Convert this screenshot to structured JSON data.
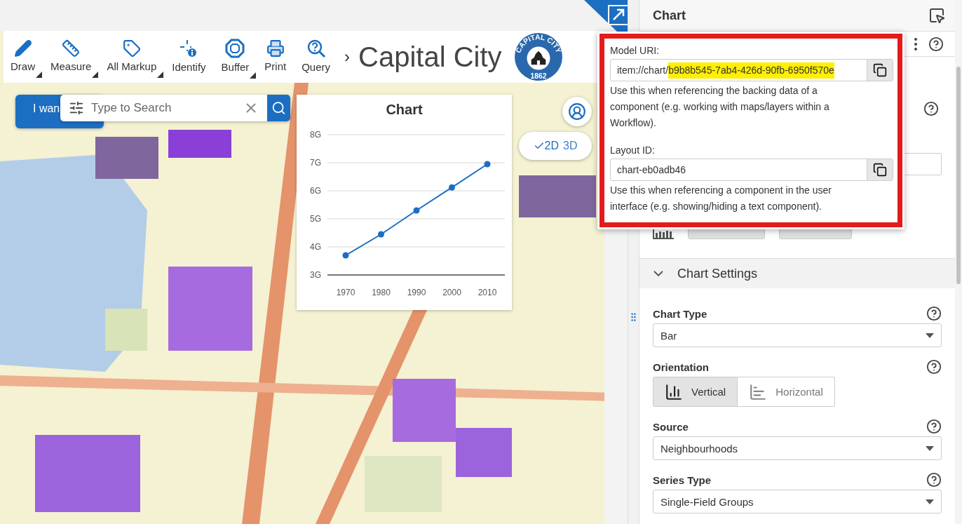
{
  "map_toolbar": {
    "tools": [
      {
        "label": "Draw",
        "has_menu": true
      },
      {
        "label": "Measure",
        "has_menu": true
      },
      {
        "label": "All Markup",
        "has_menu": true
      },
      {
        "label": "Identify",
        "has_menu": false
      },
      {
        "label": "Buffer",
        "has_menu": true
      },
      {
        "label": "Print",
        "has_menu": false
      },
      {
        "label": "Query",
        "has_menu": false
      }
    ],
    "separator": "›",
    "title": "Capital City",
    "logo": {
      "ring_text": "CAPITAL CITY",
      "year": "1862"
    }
  },
  "map": {
    "kind": "picture",
    "i_want_button": "I wan",
    "search": {
      "placeholder": "Type to Search"
    },
    "view_toggle": [
      {
        "label": "2D",
        "selected": true
      },
      {
        "label": "3D",
        "selected": false
      }
    ],
    "chart_card": {
      "title": "Chart",
      "chart_data": {
        "type": "line",
        "categories": [
          "1970",
          "1980",
          "1990",
          "2000",
          "2010"
        ],
        "series": [
          {
            "color": "#1b6ec2",
            "marker": true,
            "values": [
              3.7,
              4.45,
              5.3,
              6.12,
              6.95
            ]
          }
        ],
        "grid": true,
        "ylim": [
          3,
          8
        ],
        "yticks": [
          {
            "value": 3,
            "label": "3G"
          },
          {
            "value": 4,
            "label": "4G"
          },
          {
            "value": 5,
            "label": "5G"
          },
          {
            "value": 6,
            "label": "6G"
          },
          {
            "value": 7,
            "label": "7G"
          },
          {
            "value": 8,
            "label": "8G"
          }
        ]
      }
    }
  },
  "panel": {
    "title": "Chart",
    "section": {
      "title": "Chart Settings",
      "expanded": true
    },
    "fields": [
      {
        "kind": "select",
        "label": "Chart Type",
        "value": "Bar"
      },
      {
        "kind": "segmented",
        "label": "Orientation",
        "options": [
          {
            "label": "Vertical",
            "selected": true
          },
          {
            "label": "Horizontal",
            "selected": false
          }
        ]
      },
      {
        "kind": "select",
        "label": "Source",
        "value": "Neighbourhoods"
      },
      {
        "kind": "select",
        "label": "Series Type",
        "value": "Single-Field Groups"
      }
    ]
  },
  "popover": {
    "model_uri": {
      "label": "Model URI:",
      "value_plain": "item://chart/",
      "value_highlighted": "b9b8b545-7ab4-426d-90fb-6950f570e",
      "help": "Use this when referencing the backing data of a component (e.g. working with maps/layers within a Workflow)."
    },
    "layout_id": {
      "label": "Layout ID:",
      "value": "chart-eb0adb46",
      "help": "Use this when referencing a component in the user interface (e.g. showing/hiding a text component)."
    }
  }
}
